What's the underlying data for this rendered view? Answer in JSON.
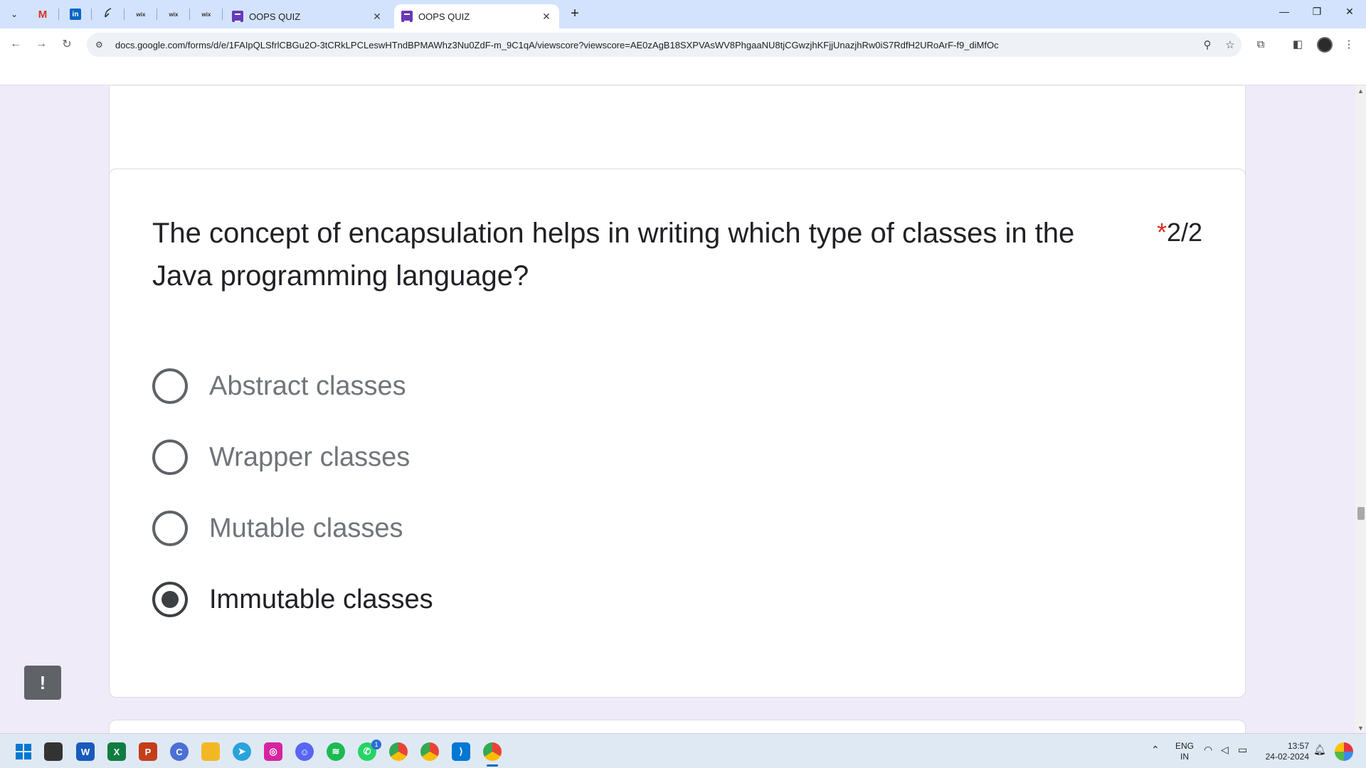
{
  "browser": {
    "tabs": [
      {
        "title": "OOPS QUIZ",
        "active": false
      },
      {
        "title": "OOPS QUIZ",
        "active": true
      }
    ],
    "url": "docs.google.com/forms/d/e/1FAIpQLSfrlCBGu2O-3tCRkLPCLeswHTndBPMAWhz3Nu0ZdF-m_9C1qA/viewscore?viewscore=AE0zAgB18SXPVAsWV8PhgaaNU8tjCGwzjhKFjjUnazjhRw0iS7RdfH2URoArF-f9_diMfOc",
    "pinned_tabs": [
      "gmail-icon",
      "linkedin-icon",
      "feather-icon",
      "wix-icon",
      "wix-icon",
      "wix-icon"
    ],
    "pinned_labels": [
      "M",
      "in",
      "",
      "wix",
      "wix",
      "wix"
    ]
  },
  "question": {
    "text": "The concept of encapsulation helps in writing which type of classes in the Java programming language?",
    "required_mark": "*",
    "score": "2/2",
    "options": [
      {
        "label": "Abstract classes",
        "selected": false
      },
      {
        "label": "Wrapper classes",
        "selected": false
      },
      {
        "label": "Mutable classes",
        "selected": false
      },
      {
        "label": "Immutable classes",
        "selected": true
      }
    ]
  },
  "feedback": {
    "label": "!"
  },
  "taskbar": {
    "apps": [
      "windows-start",
      "file-explorer-desk",
      "word",
      "excel",
      "powerpoint",
      "edge-like",
      "folder",
      "telegram",
      "instagram",
      "discord",
      "spotify",
      "whatsapp",
      "chrome",
      "chrome-profile",
      "vscode",
      "chrome-active"
    ],
    "whatsapp_badge": "1",
    "language_line1": "ENG",
    "language_line2": "IN",
    "time": "13:57",
    "date": "24-02-2024"
  },
  "colors": {
    "page_bg": "#f0ebf8",
    "required": "#d93025",
    "forms_purple": "#673ab7"
  }
}
